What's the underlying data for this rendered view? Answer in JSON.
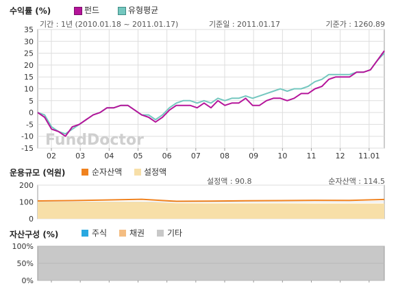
{
  "colors": {
    "fund": "#b5149a",
    "type_avg": "#74c7bf",
    "net_assets": "#f0821e",
    "setup": "#f7dfa8",
    "stock": "#29a8e0",
    "bond": "#f4bd82",
    "other": "#c8c8c8",
    "grid": "#dddddd",
    "axis": "#999999"
  },
  "returns": {
    "title": "수익률 (%)",
    "legend_fund": "펀드",
    "legend_avg": "유형평균",
    "period": "기간 : 1년 (2010.01.18 ~ 2011.01.17)",
    "base_date": "기준일 : 2011.01.17",
    "base_price": "기준가 : 1260.89",
    "watermark": "FundDoctor"
  },
  "size": {
    "title": "운용규모 (억원)",
    "legend_net": "순자산액",
    "legend_setup": "설정액",
    "setup_value": "설정액 : 90.8",
    "net_value": "순자산액 : 114.5"
  },
  "composition": {
    "title": "자산구성 (%)",
    "legend_stock": "주식",
    "legend_bond": "채권",
    "legend_other": "기타"
  },
  "chart_data": [
    {
      "type": "line",
      "title": "수익률 (%)",
      "x_tick_labels": [
        "02",
        "03",
        "04",
        "05",
        "06",
        "07",
        "08",
        "09",
        "10",
        "11",
        "12",
        "11.01"
      ],
      "ylim": [
        -15,
        35
      ],
      "y_ticks": [
        -15,
        -10,
        -5,
        0,
        5,
        10,
        15,
        20,
        25,
        30,
        35
      ],
      "grid": true,
      "x": [
        0,
        0.02,
        0.04,
        0.06,
        0.08,
        0.1,
        0.12,
        0.14,
        0.16,
        0.18,
        0.2,
        0.22,
        0.24,
        0.26,
        0.28,
        0.3,
        0.32,
        0.34,
        0.36,
        0.38,
        0.4,
        0.42,
        0.44,
        0.46,
        0.48,
        0.5,
        0.52,
        0.54,
        0.56,
        0.58,
        0.6,
        0.62,
        0.64,
        0.66,
        0.68,
        0.7,
        0.72,
        0.74,
        0.76,
        0.78,
        0.8,
        0.82,
        0.84,
        0.86,
        0.88,
        0.9,
        0.92,
        0.94,
        0.96,
        0.98,
        1.0
      ],
      "series": [
        {
          "name": "펀드",
          "color": "#b5149a",
          "values": [
            0,
            -2,
            -7,
            -8,
            -10,
            -6,
            -5,
            -3,
            -1,
            0,
            2,
            2,
            3,
            3,
            1,
            -1,
            -2,
            -4,
            -2,
            1,
            3,
            3,
            3,
            2,
            4,
            2,
            5,
            3,
            4,
            4,
            6,
            3,
            3,
            5,
            6,
            6,
            5,
            6,
            8,
            8,
            10,
            11,
            14,
            15,
            15,
            15,
            17,
            17,
            18,
            22,
            26
          ]
        },
        {
          "name": "유형평균",
          "color": "#74c7bf",
          "values": [
            0,
            -1,
            -6,
            -8,
            -9,
            -7,
            -5,
            -3,
            -1,
            0,
            2,
            2,
            3,
            3,
            1,
            -1,
            -1,
            -3,
            -1,
            2,
            4,
            5,
            5,
            4,
            5,
            4,
            6,
            5,
            6,
            6,
            7,
            6,
            7,
            8,
            9,
            10,
            9,
            10,
            10,
            11,
            13,
            14,
            16,
            16,
            16,
            16,
            17,
            17,
            18,
            22,
            25
          ]
        }
      ]
    },
    {
      "type": "area",
      "title": "운용규모 (억원)",
      "ylim": [
        0,
        200
      ],
      "y_ticks": [
        0,
        100,
        200
      ],
      "grid": true,
      "x": [
        0,
        0.1,
        0.2,
        0.3,
        0.4,
        0.5,
        0.6,
        0.7,
        0.8,
        0.9,
        1.0
      ],
      "series": [
        {
          "name": "순자산액",
          "color": "#f0821e",
          "values": [
            106,
            108,
            112,
            116,
            104,
            105,
            107,
            108,
            110,
            109,
            114.5
          ]
        },
        {
          "name": "설정액",
          "color": "#f7dfa8",
          "values": [
            100,
            100,
            100,
            100,
            93,
            92,
            92,
            92,
            91,
            91,
            90.8
          ]
        }
      ]
    },
    {
      "type": "area",
      "title": "자산구성 (%)",
      "ylim": [
        0,
        100
      ],
      "y_ticks": [
        "0%",
        "50%",
        "100%"
      ],
      "series": [
        {
          "name": "주식",
          "color": "#29a8e0",
          "values": [
            0,
            0
          ]
        },
        {
          "name": "채권",
          "color": "#f4bd82",
          "values": [
            0,
            0
          ]
        },
        {
          "name": "기타",
          "color": "#c8c8c8",
          "values": [
            100,
            100
          ]
        }
      ]
    }
  ]
}
